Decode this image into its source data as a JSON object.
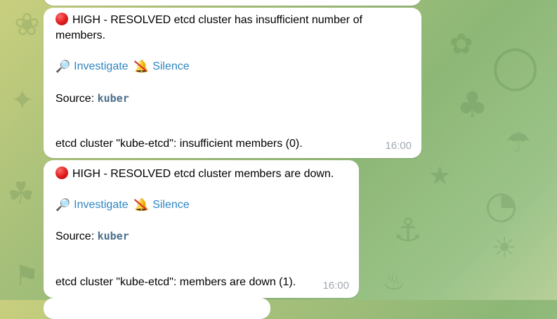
{
  "messages": [
    {
      "severity_icon": "red-circle-icon",
      "title": "HIGH - RESOLVED etcd cluster has insufficient number of members.",
      "investigate_label": "Investigate",
      "silence_label": "Silence",
      "source_label": "Source:",
      "source_value": "kuber",
      "description": "etcd cluster \"kube-etcd\": insufficient members (0).",
      "time": "16:00"
    },
    {
      "severity_icon": "red-circle-icon",
      "title": "HIGH - RESOLVED etcd cluster members are down.",
      "investigate_label": "Investigate",
      "silence_label": "Silence",
      "source_label": "Source:",
      "source_value": "kuber",
      "description": "etcd cluster \"kube-etcd\": members are down (1).",
      "time": "16:00"
    }
  ],
  "colors": {
    "link": "#2f86c2",
    "timestamp": "#a1aab3",
    "bubble": "#ffffff",
    "severity_red": "#e01b1b"
  }
}
